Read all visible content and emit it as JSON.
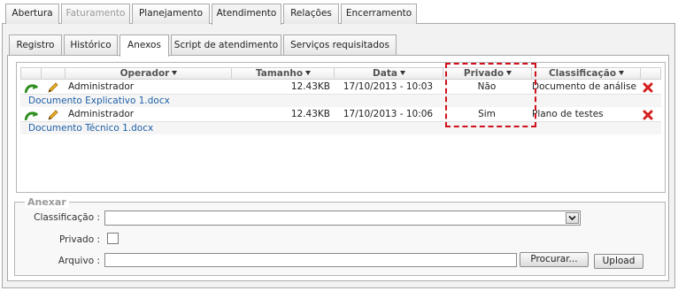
{
  "top_tabs": [
    {
      "label": "Abertura"
    },
    {
      "label": "Faturamento"
    },
    {
      "label": "Planejamento"
    },
    {
      "label": "Atendimento"
    },
    {
      "label": "Relações"
    },
    {
      "label": "Encerramento"
    }
  ],
  "sub_tabs": [
    {
      "label": "Registro"
    },
    {
      "label": "Histórico"
    },
    {
      "label": "Anexos"
    },
    {
      "label": "Script de atendimento"
    },
    {
      "label": "Serviços requisitados"
    }
  ],
  "grid": {
    "headers": {
      "operador": "Operador",
      "tamanho": "Tamanho",
      "data": "Data",
      "privado": "Privado",
      "classificacao": "Classificação"
    },
    "rows": [
      {
        "operador": "Administrador",
        "tamanho": "12.43KB",
        "data": "17/10/2013 - 10:03",
        "privado": "Não",
        "classificacao": "Documento de análise",
        "file": "Documento Explicativo 1.docx"
      },
      {
        "operador": "Administrador",
        "tamanho": "12.43KB",
        "data": "17/10/2013 - 10:06",
        "privado": "Sim",
        "classificacao": "Plano de testes",
        "file": "Documento Técnico 1.docx"
      }
    ],
    "icons": {
      "download": "green-arrow-icon",
      "edit": "pencil-icon",
      "delete": "red-x-icon"
    }
  },
  "anexar": {
    "legend": "Anexar",
    "classificacao_label": "Classificação :",
    "classificacao_value": "",
    "privado_label": "Privado :",
    "arquivo_label": "Arquivo :",
    "arquivo_value": "",
    "browse_button": "Procurar...",
    "upload_button": "Upload"
  },
  "colors": {
    "highlight": "#d0101a",
    "link": "#1d5fa7"
  }
}
